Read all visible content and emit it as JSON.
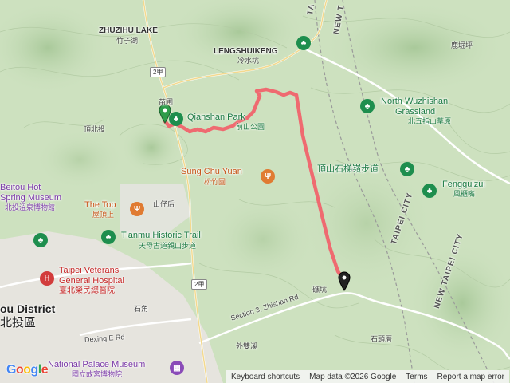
{
  "places": {
    "zhuzihu_en": "ZHUZIHU LAKE",
    "zhuzihu_zh": "竹子湖",
    "lengshuikeng_en": "LENGSHUIKENG",
    "lengshuikeng_zh": "冷水坑",
    "qianshan_en": "Qianshan Park",
    "qianshan_zh": "前山公園",
    "miaopu_zh": "苗圃",
    "dingbeitou_zh": "頂北投",
    "nwz_en_1": "North Wuzhishan",
    "nwz_en_2": "Grassland",
    "nwz_zh": "北五指山草原",
    "luku_zh": "鹿堀坪",
    "dingshan_zh": "頂山石梯嶺步道",
    "fengguizui_en": "Fengguizui",
    "fengguizui_zh": "風櫃嘴",
    "sungchu_en": "Sung Chu Yuan",
    "sungchu_zh": "松竹園",
    "thetop_en": "The Top",
    "thetop_zh": "屋頂上",
    "shanzaihou_zh": "山仔后",
    "tianmu_en": "Tianmu Historic Trail",
    "tianmu_zh": "天母古道親山步道",
    "beitou_museum_en_1": "Beitou Hot",
    "beitou_museum_en_2": "Spring Museum",
    "beitou_museum_zh": "北投溫泉博物館",
    "hospital_en_1": "Taipei Veterans",
    "hospital_en_2": "General Hospital",
    "hospital_zh": "臺北榮民總醫院",
    "district_en": "ou District",
    "district_zh": "北投區",
    "shijiao_zh": "石角",
    "dexing_en": "Dexing E Rd",
    "waishuangxi_zh": "外雙溪",
    "zhishan_en": "Section 3, Zhishan Rd",
    "dankeng_zh": "礁坑",
    "shitoucuo_zh": "石頭厝",
    "palace_en": "National Palace Museum",
    "palace_zh": "國立故宮博物院",
    "taipei_city_en": "TAIPEI CITY",
    "new_taipei_en": "NEW TAIPEI CITY",
    "ta_top": "TA",
    "new_t_top": "NEW T"
  },
  "roads": {
    "route2jia_1": "2甲",
    "route2jia_2": "2甲"
  },
  "icons": {
    "park": "tree-icon",
    "food": "restaurant-icon",
    "hospital": "hospital-icon",
    "museum": "museum-icon",
    "start": "start-pin-icon",
    "end": "end-pin-icon"
  },
  "colors": {
    "route": "#f0636b",
    "park_green": "#1e8e4e",
    "food_orange": "#e07b32",
    "hospital_red": "#d23c3c",
    "museum_purple": "#8a4bb8",
    "start_pin": "#2e9d4a",
    "end_pin": "#222222"
  },
  "attribution": {
    "shortcuts": "Keyboard shortcuts",
    "data": "Map data ©2026 Google",
    "terms": "Terms",
    "report": "Report a map error"
  },
  "logo": "Google"
}
